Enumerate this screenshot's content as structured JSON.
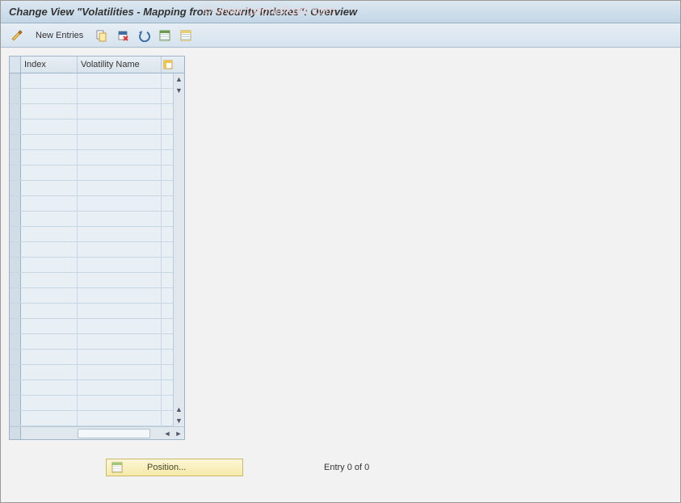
{
  "header": {
    "title": "Change View \"Volatilities - Mapping from Security Indexes\": Overview",
    "watermark": "© www.tutorialkart.com"
  },
  "toolbar": {
    "new_entries_label": "New Entries",
    "icons": {
      "toggle": "toggle-change-display",
      "copy": "copy-as",
      "delete": "delete",
      "undo": "undo-change",
      "select_all": "select-all",
      "deselect_all": "deselect-all"
    }
  },
  "table": {
    "columns": {
      "index": "Index",
      "volatility_name": "Volatility Name"
    },
    "row_count": 23,
    "config_icon": "table-settings"
  },
  "footer": {
    "position_label": "Position...",
    "entry_text": "Entry 0 of 0"
  }
}
